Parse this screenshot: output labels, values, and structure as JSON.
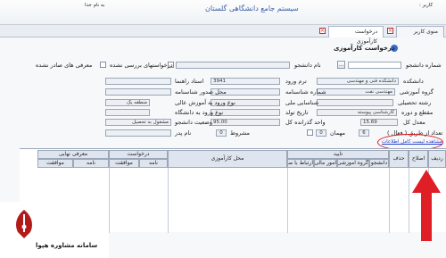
{
  "app": {
    "title": "سیستم جامع دانشگاهی گلستان",
    "welcome": "به نام خدا",
    "user_line": "کاربر :"
  },
  "tabs": [
    {
      "label": "منوی کاربر"
    },
    {
      "label": "درخواست کارآموزی"
    }
  ],
  "form": {
    "header": "درخواست کارآموزی",
    "rows": {
      "student_no_label": "شماره دانشجو",
      "name_label": "نام دانشجو",
      "requests_label": "درخواستهای بررسی نشده",
      "introductions_label": "معرفی های صادر نشده",
      "faculty_label": "دانشکده",
      "faculty_value": "دانشکده فنی و مهندسی",
      "entry_term_label": "ترم ورود",
      "entry_term_value": "3941",
      "advisor_label": "استاد راهنما",
      "group_label": "گروه آموزشی",
      "group_value": "مهندسی نفت",
      "id_no_label": "شماره شناسنامه",
      "id_place_label": "محل صدور شناسنامه",
      "major_label": "رشته تحصیلی",
      "national_id_label": "شناسایی ملی",
      "entry_type_label": "نوع ورود به آموزش عالی",
      "entry_type_value": "منطقه یک",
      "level_label": "مقطع و دوره",
      "level_value": "کارشناسی پیوسته",
      "birth_label": "تاریخ تولد",
      "entry_uni_label": "نوع ورود به دانشگاه",
      "gpa_label": "معدل کل",
      "gpa_value": "15.69",
      "units_label": "واحد گذرانده کل",
      "units_value": "95.00",
      "status_label": "وضعیت دانشجو",
      "status_value": "مشغول به تحصیل",
      "active_count_label": "تعداد از طریق ( فعال )",
      "active_count_value": "6",
      "guest_label": "مهمان",
      "guest_value": "0",
      "conditional_label": "مشروط",
      "conditional_value": "0",
      "father_label": "نام پدر"
    },
    "link_label": "مشاهده لیست کامل اطلاعات"
  },
  "grid": {
    "columns_right_to_left": [
      "ردیف",
      "اصلاح",
      "حذف",
      "دانشجو",
      "گروه آموزشی",
      "امور مالی",
      "ارتباط با صنعت",
      "محل کارآموزی",
      "نامه",
      "موافقت",
      "نامه",
      "موافقت"
    ],
    "group_headers": {
      "approve": "تایید",
      "request": "درخواست",
      "final_intro": "معرفی نهایی"
    },
    "rows": []
  },
  "logo": {
    "text": "سامانه مشاوره هپوا"
  },
  "colors": {
    "accent_red": "#d9131a",
    "link_blue": "#2b43c9",
    "header_bg": "#dfe5ee"
  }
}
